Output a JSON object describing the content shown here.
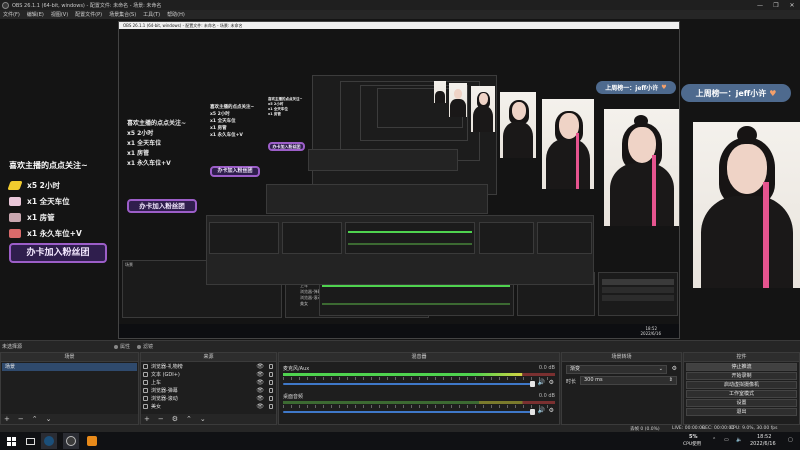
{
  "window": {
    "title": "OBS 26.1.1 (64-bit, windows) - 配置文件: 未命名 - 场景: 未命名",
    "controls": [
      "—",
      "❐",
      "✕"
    ]
  },
  "menu": [
    "文件(F)",
    "编辑(E)",
    "视图(V)",
    "配置文件(P)",
    "场景集合(S)",
    "工具(T)",
    "帮助(H)"
  ],
  "preview": {
    "alert": {
      "heading": "喜欢主播的点点关注~",
      "rows": [
        {
          "icon": "gold-bar-icon",
          "text": "x5 2小时"
        },
        {
          "icon": "car-icon",
          "text": "x1 全天车位"
        },
        {
          "icon": "seat-icon",
          "text": "x1 房管"
        },
        {
          "icon": "motorcycle-icon",
          "text": "x1 永久车位+V"
        }
      ],
      "badge": "办卡加入粉丝团"
    },
    "rank_labels": [
      "上周榜一：jeff小许",
      "上周榜一：jeff小许"
    ],
    "nested_title": "OBS 26.1.1 (64-bit, windows) - 配置文件: 未命名 - 场景: 未命名",
    "nested_scene_items": [
      "场景",
      "浏览器-礼物榜",
      "文本 (GDI+)",
      "上车",
      "浏览器-弹幕",
      "浏览器-滚动",
      "美女"
    ],
    "nested_clock": {
      "time": "18:52",
      "date": "2022/6/16"
    }
  },
  "dock_bar": {
    "current_scene": "未选择源",
    "properties": "属性",
    "filters": "滤镜"
  },
  "scenes": {
    "title": "场景",
    "items": [
      "场景"
    ]
  },
  "sources": {
    "title": "来源",
    "items": [
      {
        "icon": "browser-icon",
        "label": "浏览器-礼物榜"
      },
      {
        "icon": "text-icon",
        "label": "文本 (GDI+)"
      },
      {
        "icon": "image-icon",
        "label": "上车"
      },
      {
        "icon": "browser-icon",
        "label": "浏览器-弹幕"
      },
      {
        "icon": "browser-icon",
        "label": "浏览器-滚动"
      },
      {
        "icon": "camera-icon",
        "label": "美女"
      }
    ]
  },
  "mixer": {
    "title": "混音器",
    "channels": [
      {
        "name": "麦克风/Aux",
        "db": "0.0 dB",
        "level": 0.88
      },
      {
        "name": "桌面音频",
        "db": "0.0 dB",
        "level": 0.0
      }
    ]
  },
  "transitions": {
    "title": "场景转场",
    "type": "渐变",
    "duration_label": "时长",
    "duration_value": "300 ms"
  },
  "controls": {
    "title": "控件",
    "buttons": [
      "停止推流",
      "开始录制",
      "启动虚拟摄像机",
      "工作室模式",
      "设置",
      "退出"
    ]
  },
  "status": {
    "dropped": "丢帧 0 (0.0%)",
    "live": "LIVE: 00:00:00",
    "rec": "REC: 00:00:00",
    "cpu": "CPU: 9.0%, 30.00 fps"
  },
  "taskbar": {
    "cpu_percent": "5%",
    "cpu_label": "CPU使用",
    "time": "18:52",
    "date": "2022/6/16"
  },
  "colors": {
    "accent": "#3f78c8",
    "badge_border": "#9c5ec8",
    "rank_bg": "#4e6a8e",
    "meter_green": "#4fd34f"
  }
}
